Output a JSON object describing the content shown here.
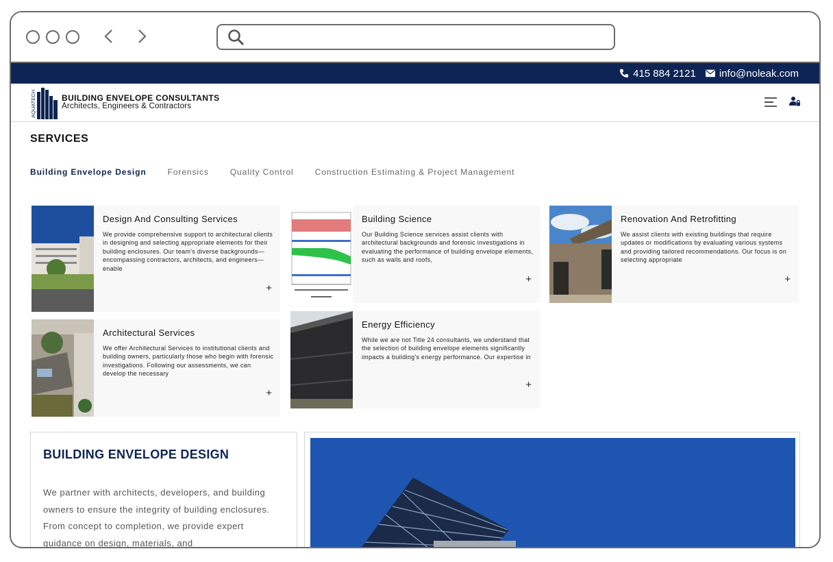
{
  "browser": {
    "search_placeholder": ""
  },
  "topbar": {
    "phone": "415 884 2121",
    "email": "info@noleak.com"
  },
  "brand": {
    "logo_text": "AQUATECH",
    "title": "BUILDING ENVELOPE CONSULTANTS",
    "subtitle": "Architects, Engineers & Contractors"
  },
  "services": {
    "title": "SERVICES",
    "tabs": [
      {
        "label": "Building Envelope Design",
        "active": true
      },
      {
        "label": "Forensics",
        "active": false
      },
      {
        "label": "Quality Control",
        "active": false
      },
      {
        "label": "Construction Estimating & Project Management",
        "active": false
      }
    ],
    "cards": [
      {
        "title": "Design And Consulting Services",
        "desc": "We provide comprehensive support to architectural clients in designing and selecting appropriate elements for their building enclosures. Our team's diverse backgrounds—encompassing contractors, architects, and engineers—enable",
        "more": "+"
      },
      {
        "title": "Building Science",
        "desc": "Our Building Science services assist clients with architectural backgrounds and forensic investigations in evaluating the performance of building envelope elements, such as walls and roofs,",
        "more": "+"
      },
      {
        "title": "Renovation And Retrofitting",
        "desc": "We assist clients with existing buildings that require updates or modifications by evaluating various systems and providing tailored recommendations. Our focus is on selecting appropriate",
        "more": "+"
      },
      {
        "title": "Architectural Services",
        "desc": "We offer Architectural Services to institutional clients and building owners, particularly those who begin with forensic investigations. Following our assessments, we can develop the necessary",
        "more": "+"
      },
      {
        "title": "Energy Efficiency",
        "desc": "While we are not Title 24 consultants, we understand that the selection of building envelope elements significantly impacts a building's energy performance. Our expertise in",
        "more": "+"
      }
    ]
  },
  "feature": {
    "title": "BUILDING ENVELOPE DESIGN",
    "body": "We partner with architects, developers, and building owners to ensure the integrity of building enclosures. From concept to completion, we provide expert guidance on design, materials, and"
  },
  "colors": {
    "navy": "#0e2454",
    "card_bg": "#f8f8f8",
    "sky": "#1e55b0"
  }
}
